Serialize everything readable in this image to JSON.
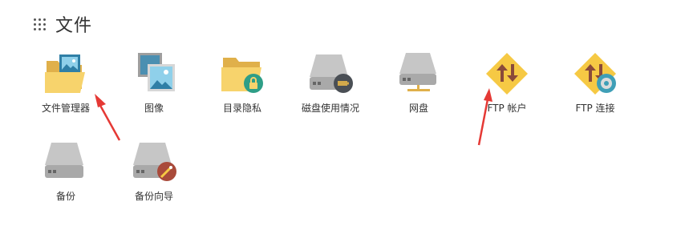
{
  "section": {
    "title": "文件"
  },
  "tiles": [
    {
      "label": "文件管理器",
      "icon": "folder-image-icon"
    },
    {
      "label": "图像",
      "icon": "images-icon"
    },
    {
      "label": "目录隐私",
      "icon": "folder-lock-icon"
    },
    {
      "label": "磁盘使用情况",
      "icon": "disk-usage-icon"
    },
    {
      "label": "网盘",
      "icon": "network-drive-icon"
    },
    {
      "label": "FTP 帐户",
      "icon": "ftp-accounts-icon"
    },
    {
      "label": "FTP 连接",
      "icon": "ftp-connections-icon"
    },
    {
      "label": "备份",
      "icon": "backup-drive-icon"
    },
    {
      "label": "备份向导",
      "icon": "backup-wizard-icon"
    }
  ],
  "colors": {
    "arrow": "#e53935",
    "folder": "#f5cc5c",
    "drive": "#bdbdbd",
    "ftp": "#f6c944"
  }
}
